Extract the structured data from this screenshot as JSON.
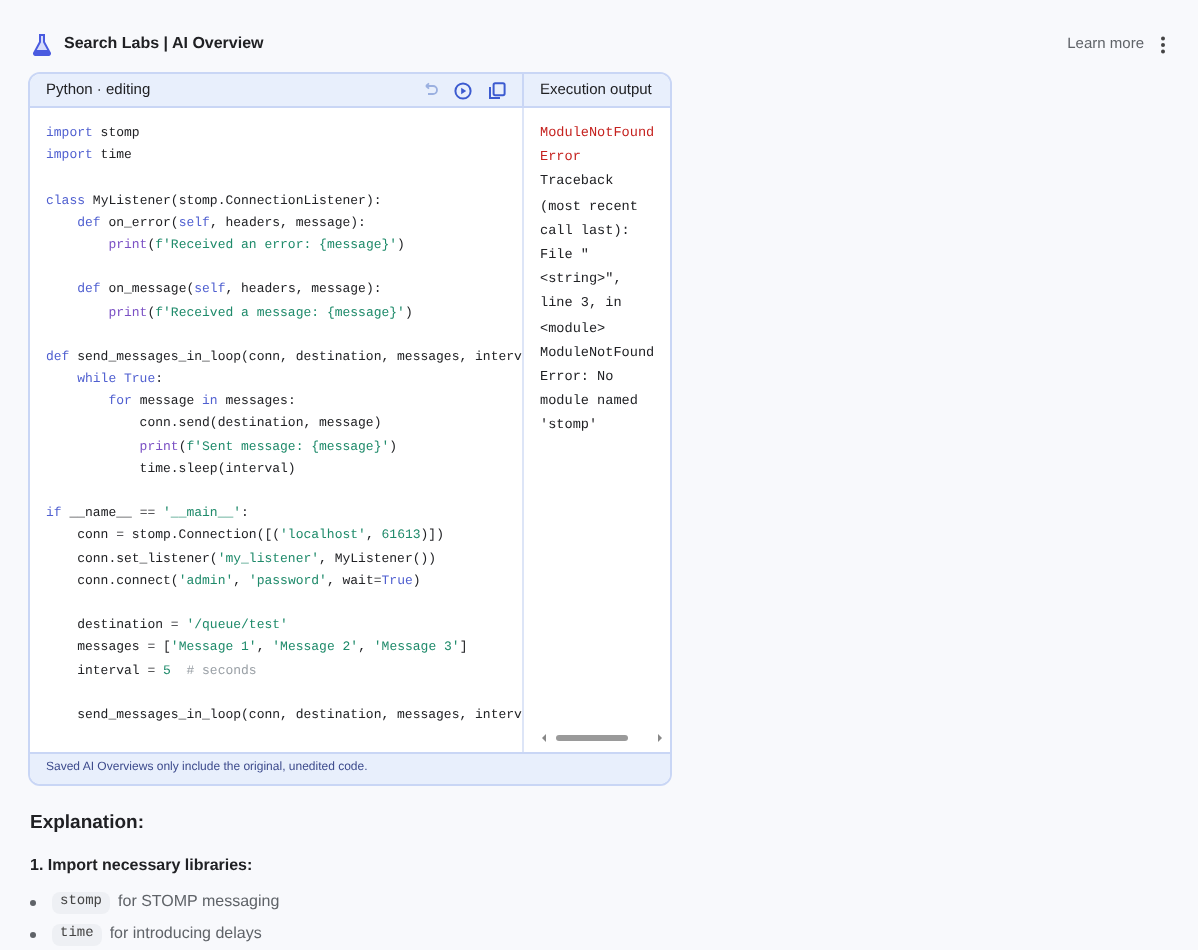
{
  "header": {
    "title": "Search Labs | AI Overview",
    "learn_more": "Learn more"
  },
  "editor": {
    "title": "Python · editing",
    "output_title": "Execution output",
    "footer": "Saved AI Overviews only include the original, unedited code.",
    "code_lines": [
      {
        "kind": "code",
        "tokens": [
          {
            "kind": "kw",
            "text": "import"
          },
          {
            "kind": "plain",
            "text": " stomp"
          }
        ]
      },
      {
        "kind": "code",
        "tokens": [
          {
            "kind": "kw",
            "text": "import"
          },
          {
            "kind": "plain",
            "text": " time"
          }
        ]
      },
      {
        "kind": "blank"
      },
      {
        "kind": "code",
        "tokens": [
          {
            "kind": "kw",
            "text": "class"
          },
          {
            "kind": "plain",
            "text": " MyListener(stomp.ConnectionListener):"
          }
        ]
      },
      {
        "kind": "code",
        "tokens": [
          {
            "kind": "kw",
            "text": "    def"
          },
          {
            "kind": "plain",
            "text": " on_error("
          },
          {
            "kind": "kw",
            "text": "self"
          },
          {
            "kind": "plain",
            "text": ", headers, message):"
          }
        ]
      },
      {
        "kind": "code",
        "tokens": [
          {
            "kind": "fn",
            "text": "        print"
          },
          {
            "kind": "plain",
            "text": "("
          },
          {
            "kind": "str",
            "text": "f'Received an error: {message}'"
          },
          {
            "kind": "plain",
            "text": ")"
          }
        ]
      },
      {
        "kind": "blank"
      },
      {
        "kind": "code",
        "tokens": [
          {
            "kind": "kw",
            "text": "    def"
          },
          {
            "kind": "plain",
            "text": " on_message("
          },
          {
            "kind": "kw",
            "text": "self"
          },
          {
            "kind": "plain",
            "text": ", headers, message):"
          }
        ]
      },
      {
        "kind": "code",
        "tokens": [
          {
            "kind": "fn",
            "text": "        print"
          },
          {
            "kind": "plain",
            "text": "("
          },
          {
            "kind": "str",
            "text": "f'Received a message: {message}'"
          },
          {
            "kind": "plain",
            "text": ")"
          }
        ]
      },
      {
        "kind": "blank"
      },
      {
        "kind": "code",
        "tokens": [
          {
            "kind": "kw",
            "text": "def"
          },
          {
            "kind": "plain",
            "text": " send_messages_in_loop(conn, destination, messages, interv"
          }
        ]
      },
      {
        "kind": "code",
        "tokens": [
          {
            "kind": "kw",
            "text": "    while True"
          },
          {
            "kind": "plain",
            "text": ":"
          }
        ]
      },
      {
        "kind": "code",
        "tokens": [
          {
            "kind": "kw",
            "text": "        for"
          },
          {
            "kind": "plain",
            "text": " message "
          },
          {
            "kind": "kw",
            "text": "in"
          },
          {
            "kind": "plain",
            "text": " messages:"
          }
        ]
      },
      {
        "kind": "code",
        "tokens": [
          {
            "kind": "plain",
            "text": "            conn.send(destination, message)"
          }
        ]
      },
      {
        "kind": "code",
        "tokens": [
          {
            "kind": "fn",
            "text": "            print"
          },
          {
            "kind": "plain",
            "text": "("
          },
          {
            "kind": "str",
            "text": "f'Sent message: {message}'"
          },
          {
            "kind": "plain",
            "text": ")"
          }
        ]
      },
      {
        "kind": "code",
        "tokens": [
          {
            "kind": "plain",
            "text": "            time.sleep(interval)"
          }
        ]
      },
      {
        "kind": "blank"
      },
      {
        "kind": "code",
        "tokens": [
          {
            "kind": "kw",
            "text": "if"
          },
          {
            "kind": "plain",
            "text": " __name__ == "
          },
          {
            "kind": "str",
            "text": "'__main__'"
          },
          {
            "kind": "plain",
            "text": ":"
          }
        ]
      },
      {
        "kind": "code",
        "tokens": [
          {
            "kind": "plain",
            "text": "    conn = stomp.Connection([("
          },
          {
            "kind": "str",
            "text": "'localhost'"
          },
          {
            "kind": "plain",
            "text": ", "
          },
          {
            "kind": "num",
            "text": "61613"
          },
          {
            "kind": "plain",
            "text": ")])"
          }
        ]
      },
      {
        "kind": "code",
        "tokens": [
          {
            "kind": "plain",
            "text": "    conn.set_listener("
          },
          {
            "kind": "str",
            "text": "'my_listener'"
          },
          {
            "kind": "plain",
            "text": ", MyListener())"
          }
        ]
      },
      {
        "kind": "code",
        "tokens": [
          {
            "kind": "plain",
            "text": "    conn.connect("
          },
          {
            "kind": "str",
            "text": "'admin'"
          },
          {
            "kind": "plain",
            "text": ", "
          },
          {
            "kind": "str",
            "text": "'password'"
          },
          {
            "kind": "plain",
            "text": ", wait="
          },
          {
            "kind": "kw",
            "text": "True"
          },
          {
            "kind": "plain",
            "text": ")"
          }
        ]
      },
      {
        "kind": "blank"
      },
      {
        "kind": "code",
        "tokens": [
          {
            "kind": "plain",
            "text": "    destination = "
          },
          {
            "kind": "str",
            "text": "'/queue/test'"
          }
        ]
      },
      {
        "kind": "code",
        "tokens": [
          {
            "kind": "plain",
            "text": "    messages = ["
          },
          {
            "kind": "str",
            "text": "'Message 1'"
          },
          {
            "kind": "plain",
            "text": ", "
          },
          {
            "kind": "str",
            "text": "'Message 2'"
          },
          {
            "kind": "plain",
            "text": ", "
          },
          {
            "kind": "str",
            "text": "'Message 3'"
          },
          {
            "kind": "plain",
            "text": "]"
          }
        ]
      },
      {
        "kind": "code",
        "tokens": [
          {
            "kind": "plain",
            "text": "    interval = "
          },
          {
            "kind": "num",
            "text": "5"
          },
          {
            "kind": "cm",
            "text": "  # seconds"
          }
        ]
      },
      {
        "kind": "blank"
      },
      {
        "kind": "code",
        "tokens": [
          {
            "kind": "plain",
            "text": "    send_messages_in_loop(conn, destination, messages, interv"
          }
        ]
      }
    ],
    "output_lines": [
      {
        "kind": "error",
        "text": "ModuleNotFound"
      },
      {
        "kind": "error",
        "text": "Error"
      },
      {
        "kind": "plain",
        "text": "Traceback"
      },
      {
        "kind": "plain",
        "text": "(most recent"
      },
      {
        "kind": "plain",
        "text": "call last):"
      },
      {
        "kind": "plain",
        "text": "File \""
      },
      {
        "kind": "plain",
        "text": "<string>\","
      },
      {
        "kind": "plain",
        "text": "line 3, in"
      },
      {
        "kind": "plain",
        "text": "<module>"
      },
      {
        "kind": "plain",
        "text": "ModuleNotFound"
      },
      {
        "kind": "plain",
        "text": "Error: No"
      },
      {
        "kind": "plain",
        "text": "module named"
      },
      {
        "kind": "plain",
        "text": "'stomp'"
      }
    ]
  },
  "explanation": {
    "heading": "Explanation:",
    "step": "1. Import necessary libraries:",
    "bullets": [
      {
        "code": "stomp",
        "text": "for STOMP messaging"
      },
      {
        "code": "time",
        "text": "for introducing delays"
      }
    ]
  }
}
